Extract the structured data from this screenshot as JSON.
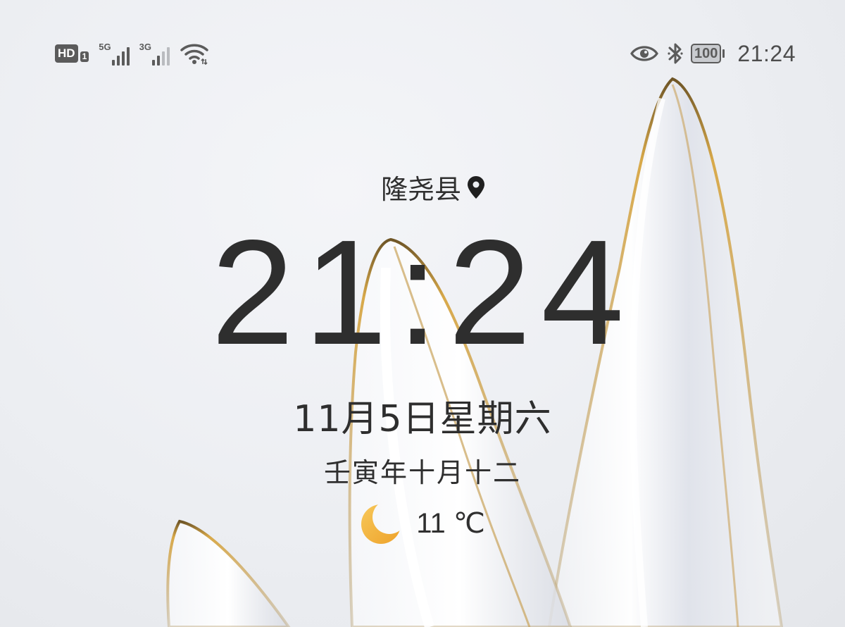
{
  "status_bar": {
    "hd_label": "HD",
    "hd_sim": "1",
    "network_1": {
      "generation": "5G",
      "signal_bars": 4,
      "signal_max": 4
    },
    "network_2": {
      "generation": "3G",
      "signal_bars": 2,
      "signal_max": 4
    },
    "wifi_icon": "wifi-icon",
    "eye_icon": "eye-comfort-icon",
    "bluetooth_icon": "bluetooth-icon",
    "battery_level": "100",
    "time": "21:24",
    "icon_color": "#5b5b5b"
  },
  "lock_screen": {
    "location": "隆尧县",
    "location_icon": "location-pin-icon",
    "clock": "21:24",
    "date": "11月5日星期六",
    "lunar_date": "壬寅年十月十二",
    "weather_icon": "crescent-moon-icon",
    "weather_icon_color": "#f2b13a",
    "temperature": "11 ℃"
  }
}
